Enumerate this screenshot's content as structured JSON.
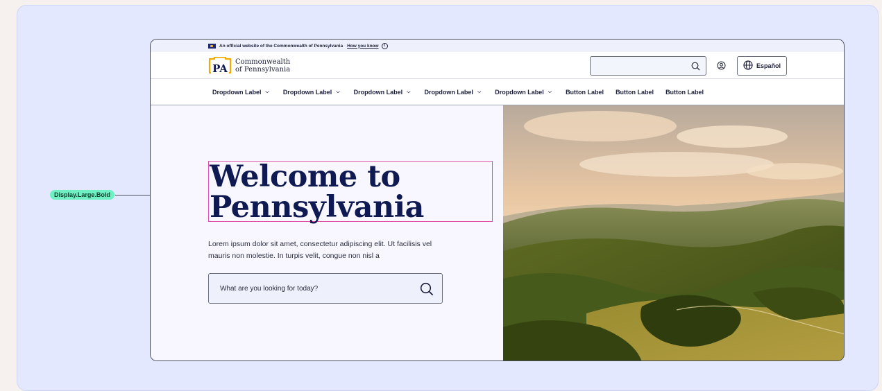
{
  "annotation": {
    "label": "Display.Large.Bold"
  },
  "gov_banner": {
    "text": "An official website of the Commonwealth of Pennsylvania",
    "link": "How you know",
    "info_icon": "i"
  },
  "header": {
    "logo_mark": "PA",
    "logo_line1": "Commonwealth",
    "logo_line2": "of Pennsylvania",
    "search_placeholder": "",
    "language_button": "Español",
    "icons": [
      "search-icon",
      "account-icon",
      "globe-icon"
    ]
  },
  "nav": {
    "dropdowns": [
      "Dropdown Label",
      "Dropdown Label",
      "Dropdown Label",
      "Dropdown Label",
      "Dropdown Label"
    ],
    "buttons": [
      "Button Label",
      "Button Label",
      "Button Label"
    ]
  },
  "hero": {
    "title_line1": "Welcome to",
    "title_line2": "Pennsylvania",
    "body": "Lorem ipsum dolor sit amet, consectetur adipiscing elit. Ut facilisis vel mauris non molestie. In turpis velit, congue non nisl a",
    "search_placeholder": "What are you looking for today?"
  },
  "colors": {
    "brand_navy": "#0f1a52",
    "brand_gold": "#f2a900",
    "annotation_green": "#6ff0c3",
    "annotation_outline": "#e04fa8"
  }
}
